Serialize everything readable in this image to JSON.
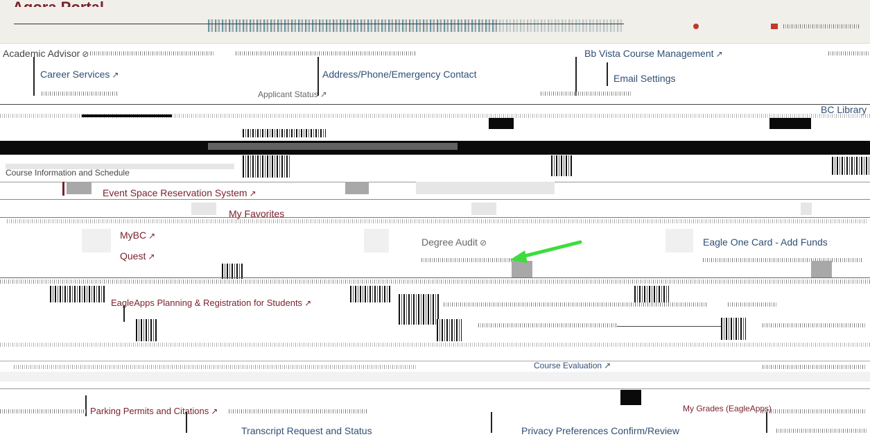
{
  "header": {
    "brand": "Agora Portal"
  },
  "links": {
    "academic_advisor": "Academic Advisor",
    "career_services": "Career Services",
    "address_phone": "Address/Phone/Emergency Contact",
    "bb_vista": "Bb Vista Course Management",
    "email_settings": "Email Settings",
    "bc_library": "BC Library",
    "event_space": "Event Space Reservation System",
    "my_favorites": "My Favorites",
    "mybc": "MyBC",
    "quest": "Quest",
    "degree_audit": "Degree Audit",
    "eagle_one_card": "Eagle One Card - Add Funds",
    "eagleapps_planning": "EagleApps Planning & Registration for Students",
    "transcript_request": "Transcript Request and Status",
    "privacy_preferences": "Privacy Preferences Confirm/Review",
    "parking_permits": "Parking Permits and Citations",
    "course_information": "Course Information and Schedule",
    "course_evaluation": "Course Evaluation",
    "applicant_status": "Applicant Status",
    "my_grades": "My Grades (EagleApps)"
  },
  "icons": {
    "external": "↗",
    "unavailable": "⊘"
  },
  "colors": {
    "link": "#2f4f74",
    "maroon": "#7a1f2b",
    "header_bg": "#f1efe9",
    "annotation_arrow": "#3ddc3d"
  }
}
